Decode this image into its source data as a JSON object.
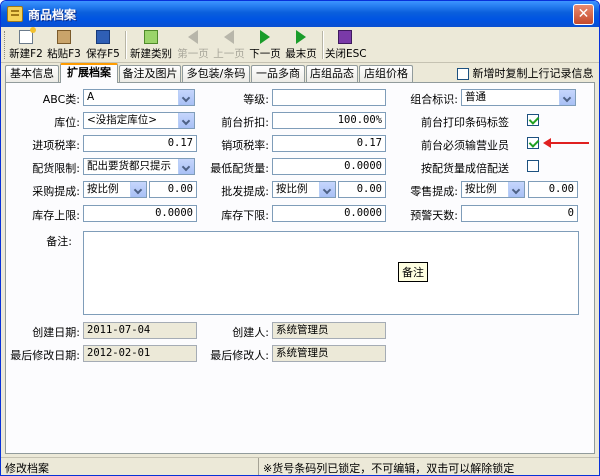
{
  "window": {
    "title": "商品档案"
  },
  "toolbar": {
    "buttons": [
      {
        "label": "新建F2",
        "icon": "new-document-icon"
      },
      {
        "label": "粘贴F3",
        "icon": "paste-icon"
      },
      {
        "label": "保存F5",
        "icon": "save-icon"
      },
      {
        "label": "新建类别",
        "icon": "new-category-icon"
      },
      {
        "label": "第一页",
        "icon": "first-page-icon",
        "enabled": false
      },
      {
        "label": "上一页",
        "icon": "previous-page-icon",
        "enabled": false
      },
      {
        "label": "下一页",
        "icon": "next-page-icon",
        "enabled": true
      },
      {
        "label": "最末页",
        "icon": "last-page-icon",
        "enabled": true
      },
      {
        "label": "关闭ESC",
        "icon": "close-door-icon"
      }
    ]
  },
  "tabs": [
    {
      "label": "基本信息",
      "active": false
    },
    {
      "label": "扩展档案",
      "active": true
    },
    {
      "label": "备注及图片",
      "active": false
    },
    {
      "label": "多包装/条码",
      "active": false
    },
    {
      "label": "一品多商",
      "active": false
    },
    {
      "label": "店组品态",
      "active": false
    },
    {
      "label": "店组价格",
      "active": false
    }
  ],
  "copy_option": {
    "label": "新增时复制上行记录信息",
    "checked": false
  },
  "form": {
    "abc_class": {
      "label": "ABC类:",
      "value": "A"
    },
    "grade": {
      "label": "等级:",
      "value": ""
    },
    "group_flag": {
      "label": "组合标识:",
      "value": "普通"
    },
    "location": {
      "label": "库位:",
      "value": "<没指定库位>"
    },
    "front_discount": {
      "label": "前台折扣:",
      "value": "100.00%"
    },
    "print_barcode": {
      "label": "前台打印条码标签",
      "checked": true
    },
    "input_tax": {
      "label": "进项税率:",
      "value": "0.17"
    },
    "output_tax": {
      "label": "销项税率:",
      "value": "0.17"
    },
    "must_enter_clerk": {
      "label": "前台必须输营业员",
      "checked": true
    },
    "delivery_limit": {
      "label": "配货限制:",
      "value": "配出要货都只提示"
    },
    "min_delivery": {
      "label": "最低配货量:",
      "value": "0.0000"
    },
    "multiple_delivery": {
      "label": "按配货量成倍配送",
      "checked": false
    },
    "purchase_commission": {
      "label": "采购提成:",
      "mode": "按比例",
      "value": "0.00"
    },
    "wholesale_commission": {
      "label": "批发提成:",
      "mode": "按比例",
      "value": "0.00"
    },
    "retail_commission": {
      "label": "零售提成:",
      "mode": "按比例",
      "value": "0.00"
    },
    "stock_max": {
      "label": "库存上限:",
      "value": "0.0000"
    },
    "stock_min": {
      "label": "库存下限:",
      "value": "0.0000"
    },
    "warning_days": {
      "label": "预警天数:",
      "value": "0"
    },
    "remark": {
      "label": "备注:",
      "value": "",
      "tooltip": "备注"
    },
    "created_date": {
      "label": "创建日期:",
      "value": "2011-07-04"
    },
    "creator": {
      "label": "创建人:",
      "value": "系统管理员"
    },
    "modified_date": {
      "label": "最后修改日期:",
      "value": "2012-02-01"
    },
    "modifier": {
      "label": "最后修改人:",
      "value": "系统管理员"
    }
  },
  "status": {
    "left": "修改档案",
    "right": "※货号条码列已锁定，不可编辑，双击可以解除锁定"
  },
  "colors": {
    "titlebar": "#0054e3",
    "panel": "#fcfcfe",
    "window": "#ece9d8",
    "annotation_arrow": "#e02020"
  }
}
